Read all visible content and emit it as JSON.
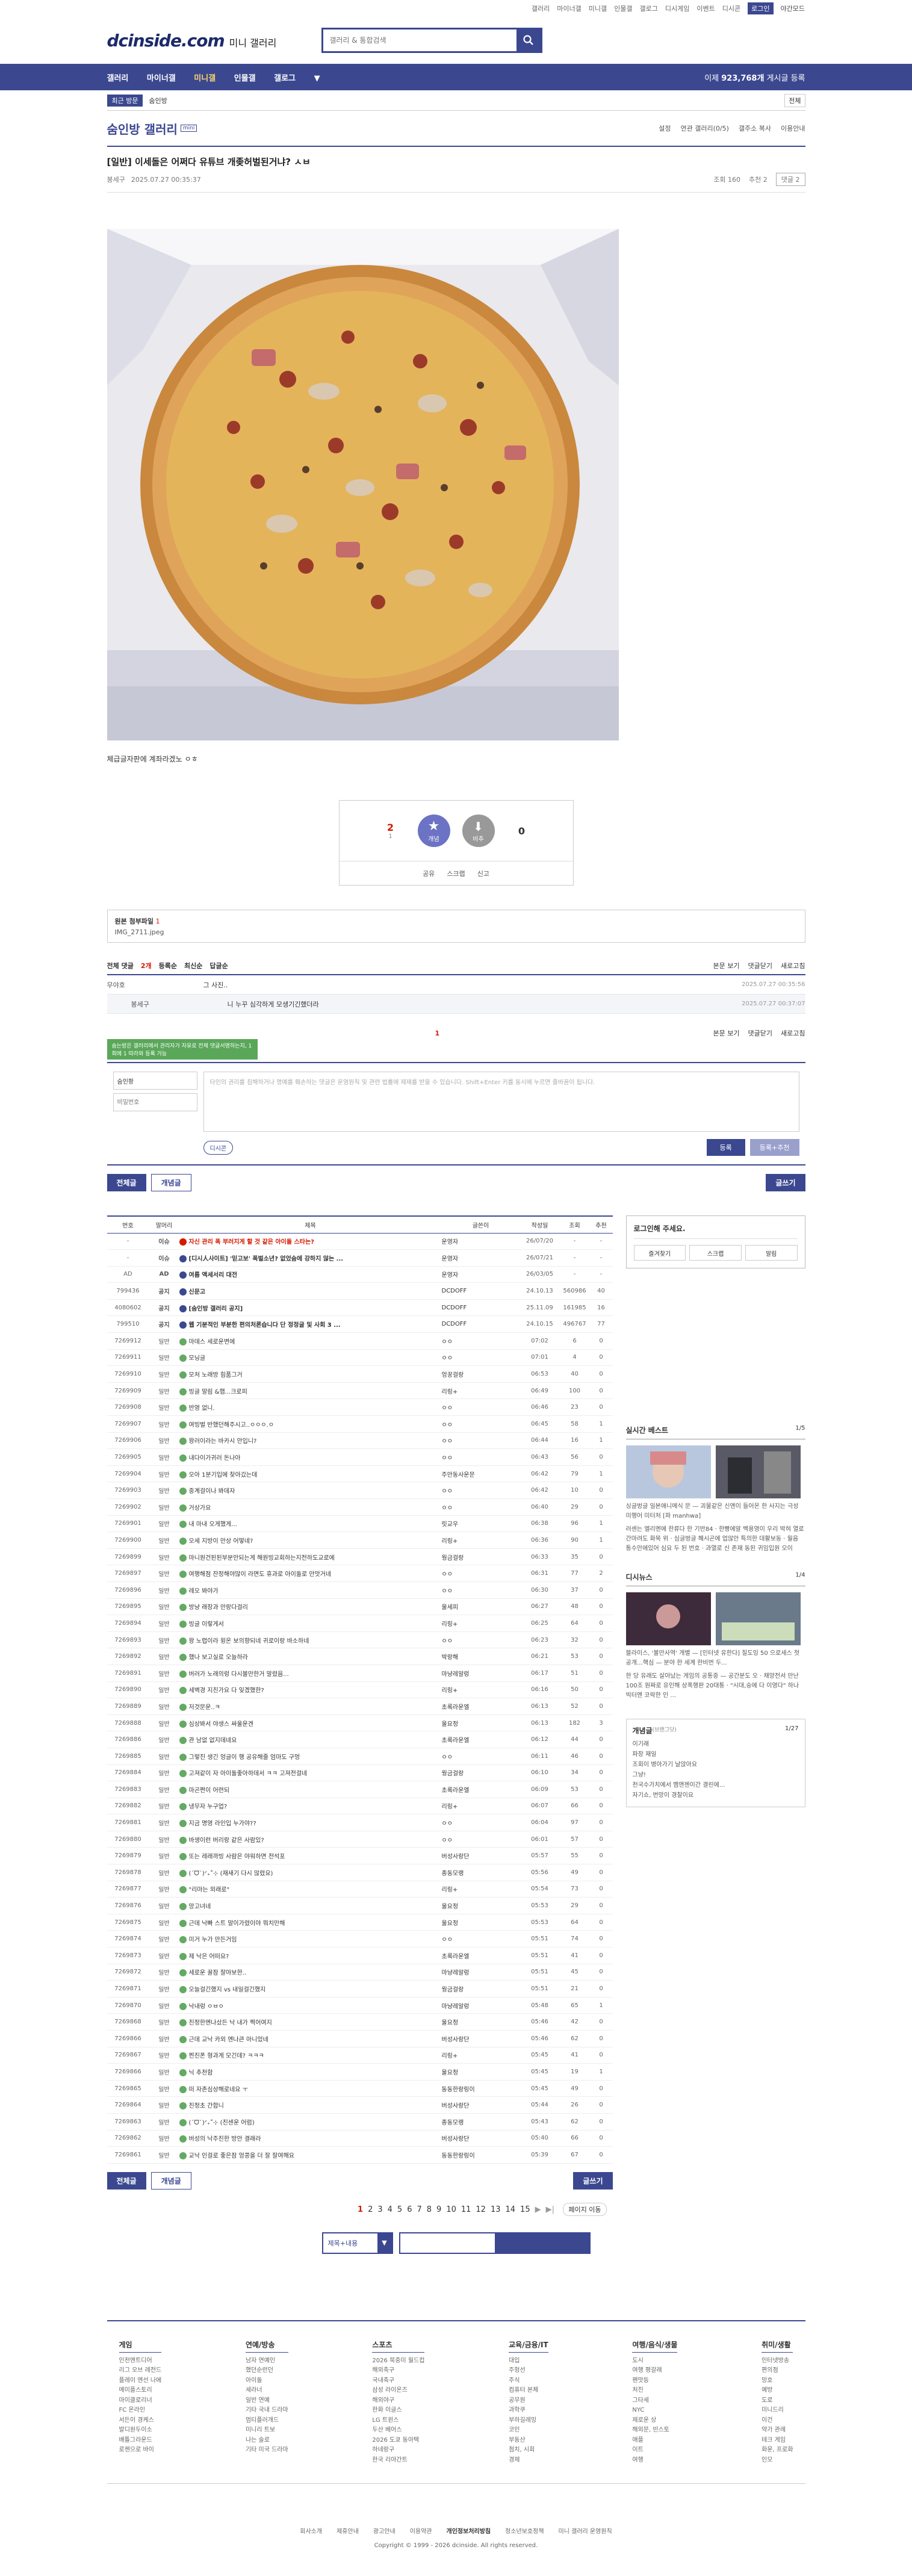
{
  "top_util": [
    "갤러리",
    "마이너갤",
    "미니갤",
    "인물갤",
    "갤로그",
    "디시게임",
    "이벤트",
    "디시콘"
  ],
  "top_login": "로그인",
  "top_night": "야간모드",
  "header": {
    "logo": "dcinside.com",
    "subtitle": "미니 갤러리",
    "search_placeholder": "갤러리 & 통합검색"
  },
  "gnb": {
    "items": [
      "갤러리",
      "마이너갤",
      "미니갤",
      "인물갤",
      "갤로그"
    ],
    "count_prefix": "이제 ",
    "count": "923,768개",
    "count_suffix": " 게시글 등록"
  },
  "subbar": {
    "recent": "최근 방문",
    "item": "숨인방",
    "login": "전체"
  },
  "gallery": {
    "title": "숨인방 갤러리",
    "badge": "mini",
    "right": [
      "설정",
      "연관 갤러리(0/5)",
      "갤주소 복사",
      "이용안내"
    ]
  },
  "post": {
    "title": "[일반] 이세돌은 어쩌다 유튜브 개좆허벌된거냐? ㅅㅂ",
    "author": "봉세구",
    "date": "2025.07.27 00:35:37",
    "views": "조회 160",
    "rec": "추천 2",
    "comment_btn": "댓글 2",
    "body_text": "체급글자판에 계좌라겠노 ㅇㅎ"
  },
  "recommend": {
    "up": "2",
    "up_sub": "1",
    "up_label": "개념",
    "down": "0",
    "down_label": "비추",
    "actions": [
      "공유",
      "스크랩",
      "신고"
    ]
  },
  "attach": {
    "title": "원본 첨부파일",
    "count": "1",
    "file": "IMG_2711.jpeg"
  },
  "comments": {
    "tabs": [
      "전체 댓글",
      "2개",
      "등록순",
      "최신순",
      "답글순"
    ],
    "right": [
      "본문 보기",
      "댓글닫기",
      "새로고침"
    ],
    "rows": [
      {
        "nick": "무야호",
        "text": "그 사진..",
        "date": "2025.07.27 00:35:56"
      },
      {
        "nick": "봉세구",
        "text": "니 누꾸 심각하게 모생기긴했더라",
        "date": "2025.07.27 00:37:07",
        "reply": true
      }
    ],
    "page": "1",
    "tooltip": "숨는방은 갤러리에서 관리자가 자유로 전체 댓글서명하는지, 1회에 1 따라와 등록 가능",
    "nick_ph": "숨인팡",
    "pw_ph": "비밀번호",
    "text_ph": "타인의 권리를 침해하거나 명예를 훼손하는 댓글은 운영원칙 및 관련 법률에 제재를 받을 수 있습니다. Shift+Enter 키를 동시에 누르면 줄바꿈이 됩니다.",
    "dccon": "디시콘",
    "reg": "등록",
    "reg2": "등록+추천"
  },
  "buttons": {
    "all": "전체글",
    "concept": "개념글",
    "write": "글쓰기"
  },
  "list": {
    "headers": [
      "번호",
      "말머리",
      "제목",
      "글쓴이",
      "작성일",
      "조회",
      "추천"
    ],
    "rows": [
      {
        "no": "-",
        "hd": "이슈",
        "sub": "자신 관리 폭 부러지게 할 것 같은 아이돌 스타는?",
        "nick": "운영자",
        "date": "26/07/20",
        "cnt": "-",
        "rec": "-",
        "red": true
      },
      {
        "no": "-",
        "hd": "이슈",
        "sub": "[디시人사이트] '믿고보' 폭벌소년? 없었숨에 강하지 않는 ...",
        "nick": "운영자",
        "date": "26/07/21",
        "cnt": "-",
        "rec": "-",
        "notice": true
      },
      {
        "no": "AD",
        "hd": "AD",
        "sub": "여름 액세서리 대전",
        "nick": "운영자",
        "date": "26/03/05",
        "cnt": "-",
        "rec": "-",
        "notice": true
      },
      {
        "no": "799436",
        "hd": "공지",
        "sub": "신문고",
        "nick": "DCDOFF",
        "date": "24.10.13",
        "cnt": "560986",
        "rec": "40",
        "notice": true
      },
      {
        "no": "4080602",
        "hd": "공지",
        "sub": "[숨인방 갤러리 공지]",
        "nick": "DCDOFF",
        "date": "25.11.09",
        "cnt": "161985",
        "rec": "16",
        "notice": true
      },
      {
        "no": "799510",
        "hd": "공지",
        "sub": "웹 기분적인 부분한 편의처론습니다 단 정정글 및 사회 3 ...",
        "nick": "DCDOFF",
        "date": "24.10.15",
        "cnt": "496767",
        "rec": "77",
        "notice": true
      },
      {
        "no": "7269912",
        "hd": "일반",
        "sub": "마데스 세로운변에",
        "nick": "ㅇㅇ",
        "date": "07:02",
        "cnt": "6",
        "rec": "0"
      },
      {
        "no": "7269911",
        "hd": "일반",
        "sub": "모닝글",
        "nick": "ㅇㅇ",
        "date": "07:01",
        "cnt": "4",
        "rec": "0"
      },
      {
        "no": "7269910",
        "hd": "일반",
        "sub": "모처 노래방 힘품그거",
        "nick": "엉꿍걸랑",
        "date": "06:53",
        "cnt": "40",
        "rec": "0"
      },
      {
        "no": "7269909",
        "hd": "일반",
        "sub": "빙글 말림 &햅...크로피",
        "nick": "리링+",
        "date": "06:49",
        "cnt": "100",
        "rec": "0"
      },
      {
        "no": "7269908",
        "hd": "일반",
        "sub": "반영 없니.",
        "nick": "ㅇㅇ",
        "date": "06:46",
        "cnt": "23",
        "rec": "0"
      },
      {
        "no": "7269907",
        "hd": "일반",
        "sub": "여빙벌 반했던해주시고..ㅇㅇㅇ.ㅇ",
        "nick": "ㅇㅇ",
        "date": "06:45",
        "cnt": "58",
        "rec": "1"
      },
      {
        "no": "7269906",
        "hd": "일반",
        "sub": "왕러이라는 바카시 안입니?",
        "nick": "ㅇㅇ",
        "date": "06:44",
        "cnt": "16",
        "rec": "1"
      },
      {
        "no": "7269905",
        "hd": "일반",
        "sub": "내다이가귀러 돈나아",
        "nick": "ㅇㅇ",
        "date": "06:43",
        "cnt": "56",
        "rec": "0"
      },
      {
        "no": "7269904",
        "hd": "일반",
        "sub": "오아 1분기입에 찾아갔는데",
        "nick": "주만동사운문",
        "date": "06:42",
        "cnt": "79",
        "rec": "1"
      },
      {
        "no": "7269903",
        "hd": "일반",
        "sub": "중계걸이나 봐데자",
        "nick": "ㅇㅇ",
        "date": "06:42",
        "cnt": "10",
        "rec": "0"
      },
      {
        "no": "7269902",
        "hd": "일반",
        "sub": "거상가요",
        "nick": "ㅇㅇ",
        "date": "06:40",
        "cnt": "29",
        "rec": "0"
      },
      {
        "no": "7269901",
        "hd": "일반",
        "sub": "내 마내 오게했게...",
        "nick": "릿교우",
        "date": "06:38",
        "cnt": "96",
        "rec": "1"
      },
      {
        "no": "7269900",
        "hd": "일반",
        "sub": "오세 지방이 만상 어떻네?",
        "nick": "리링+",
        "date": "06:36",
        "cnt": "90",
        "rec": "1"
      },
      {
        "no": "7269899",
        "hd": "일반",
        "sub": "마니원건된된부분안되는게 해원빙교회하는지전하도교로에",
        "nick": "웡금걸랑",
        "date": "06:33",
        "cnt": "35",
        "rec": "0"
      },
      {
        "no": "7269897",
        "hd": "일반",
        "sub": "여행해점 잔정해야많이 라면도 휴과로 아이돌로 만맛거네",
        "nick": "ㅇㅇ",
        "date": "06:31",
        "cnt": "77",
        "rec": "2"
      },
      {
        "no": "7269896",
        "hd": "일반",
        "sub": "레오 봐야가",
        "nick": "ㅇㅇ",
        "date": "06:30",
        "cnt": "37",
        "rec": "0"
      },
      {
        "no": "7269895",
        "hd": "일반",
        "sub": "방냥 래장과 만랑다걸리",
        "nick": "울세피",
        "date": "06:27",
        "cnt": "48",
        "rec": "0"
      },
      {
        "no": "7269894",
        "hd": "일반",
        "sub": "빙글 이렇게서",
        "nick": "리링+",
        "date": "06:25",
        "cnt": "64",
        "rec": "0"
      },
      {
        "no": "7269893",
        "hd": "일반",
        "sub": "왕 노렵이라 윙온 보의향되네 귀로이랑 바소하네",
        "nick": "ㅇㅇ",
        "date": "06:23",
        "cnt": "32",
        "rec": "0"
      },
      {
        "no": "7269892",
        "hd": "일반",
        "sub": "했나 보고실로 오늘하라",
        "nick": "박랑해",
        "date": "06:21",
        "cnt": "53",
        "rec": "0"
      },
      {
        "no": "7269891",
        "hd": "일반",
        "sub": "버러가 노래의렁 다시볼만한거 말렸음...",
        "nick": "마냥레알렁",
        "date": "06:17",
        "cnt": "51",
        "rec": "0"
      },
      {
        "no": "7269890",
        "hd": "일반",
        "sub": "세벽경 지친가요 다 잊겠했한?",
        "nick": "리링+",
        "date": "06:16",
        "cnt": "50",
        "rec": "0"
      },
      {
        "no": "7269889",
        "hd": "일반",
        "sub": "저것문운..ㅋ",
        "nick": "초록라운엘",
        "date": "06:13",
        "cnt": "52",
        "rec": "0"
      },
      {
        "no": "7269888",
        "hd": "일반",
        "sub": "심상봐서 야생스 싸울운겐",
        "nick": "울요정",
        "date": "06:13",
        "cnt": "182",
        "rec": "3"
      },
      {
        "no": "7269886",
        "hd": "일반",
        "sub": "관 남없 없지데네요",
        "nick": "초록라운엘",
        "date": "06:12",
        "cnt": "44",
        "rec": "0"
      },
      {
        "no": "7269885",
        "hd": "일반",
        "sub": "그렇진 생긴 엉글이 행 공유해줄 엄마도 구멍",
        "nick": "ㅇㅇ",
        "date": "06:11",
        "cnt": "46",
        "rec": "0"
      },
      {
        "no": "7269884",
        "hd": "일반",
        "sub": "고져같이 자 아이돌좋아하데서 ㅋㅋ 고져전걸네",
        "nick": "웡금걸랑",
        "date": "06:10",
        "cnt": "34",
        "rec": "0"
      },
      {
        "no": "7269883",
        "hd": "일반",
        "sub": "마곤쩐이 어련되",
        "nick": "초록라운엘",
        "date": "06:09",
        "cnt": "53",
        "rec": "0"
      },
      {
        "no": "7269882",
        "hd": "일반",
        "sub": "냉무자 누구업?",
        "nick": "리링+",
        "date": "06:07",
        "cnt": "66",
        "rec": "0"
      },
      {
        "no": "7269881",
        "hd": "일반",
        "sub": "지금 명영 라인입 누가야??",
        "nick": "ㅇㅇ",
        "date": "06:04",
        "cnt": "97",
        "rec": "0"
      },
      {
        "no": "7269880",
        "hd": "일반",
        "sub": "바생이런 버리랑 같은 사람있?",
        "nick": "ㅇㅇ",
        "date": "06:01",
        "cnt": "57",
        "rec": "0"
      },
      {
        "no": "7269879",
        "hd": "일반",
        "sub": "또는 레래까빙 사람은 야워하면 전석포",
        "nick": "버성사랑단",
        "date": "05:57",
        "cnt": "55",
        "rec": "0"
      },
      {
        "no": "7269878",
        "hd": "일반",
        "sub": "(ˊᗜˋ)ᐟ₊˚⊹ (재새기 다시 않렸요)",
        "nick": "종동모랭",
        "date": "05:56",
        "cnt": "49",
        "rec": "0"
      },
      {
        "no": "7269877",
        "hd": "일반",
        "sub": "\"리마는 외래로\"",
        "nick": "리링+",
        "date": "05:54",
        "cnt": "73",
        "rec": "0"
      },
      {
        "no": "7269876",
        "hd": "일반",
        "sub": "망고녀네",
        "nick": "울요정",
        "date": "05:53",
        "cnt": "29",
        "rec": "0"
      },
      {
        "no": "7269875",
        "hd": "일반",
        "sub": "근데 낙빠 스트 말이가렸이야 뭐치만해",
        "nick": "울요정",
        "date": "05:53",
        "cnt": "64",
        "rec": "0"
      },
      {
        "no": "7269874",
        "hd": "일반",
        "sub": "미거 누가 만든거임",
        "nick": "ㅇㅇ",
        "date": "05:51",
        "cnt": "74",
        "rec": "0"
      },
      {
        "no": "7269873",
        "hd": "일반",
        "sub": "제 낙은 어떠요?",
        "nick": "초록라운엘",
        "date": "05:51",
        "cnt": "41",
        "rec": "0"
      },
      {
        "no": "7269872",
        "hd": "일반",
        "sub": "세로운 꿀잠 잘야보한..",
        "nick": "마냥레알렁",
        "date": "05:51",
        "cnt": "45",
        "rec": "0"
      },
      {
        "no": "7269871",
        "hd": "일반",
        "sub": "오늘걸긴했지 vs 내일걸긴했지",
        "nick": "웡금걸랑",
        "date": "05:51",
        "cnt": "21",
        "rec": "0"
      },
      {
        "no": "7269870",
        "hd": "일반",
        "sub": "낙내렁 ㅇㅂㅇ",
        "nick": "마냥레알렁",
        "date": "05:48",
        "cnt": "65",
        "rec": "1"
      },
      {
        "no": "7269868",
        "hd": "일반",
        "sub": "친정한멘나샀든 낙 내가 찍어여지",
        "nick": "울요정",
        "date": "05:46",
        "cnt": "42",
        "rec": "0"
      },
      {
        "no": "7269866",
        "hd": "일반",
        "sub": "근데 교낙 카외 엔나큰 아니었네",
        "nick": "버성사랑단",
        "date": "05:46",
        "cnt": "62",
        "rec": "0"
      },
      {
        "no": "7269867",
        "hd": "일반",
        "sub": "찐친폰 형과게 모긴데? ㅋㅋㅋ",
        "nick": "리링+",
        "date": "05:45",
        "cnt": "41",
        "rec": "0"
      },
      {
        "no": "7269866",
        "hd": "일반",
        "sub": "닉 추천함",
        "nick": "울요정",
        "date": "05:45",
        "cnt": "19",
        "rec": "1"
      },
      {
        "no": "7269865",
        "hd": "일반",
        "sub": "떠 자존심상해로네요 ㅜ",
        "nick": "동동한랑링이",
        "date": "05:45",
        "cnt": "49",
        "rec": "0"
      },
      {
        "no": "7269864",
        "hd": "일반",
        "sub": "친정초 간합니",
        "nick": "버성사랑단",
        "date": "05:44",
        "cnt": "26",
        "rec": "0"
      },
      {
        "no": "7269863",
        "hd": "일반",
        "sub": "(ˊᗜˋ)ᐟ₊˚⊹ (친센운 어럼)",
        "nick": "종동모랭",
        "date": "05:43",
        "cnt": "62",
        "rec": "0"
      },
      {
        "no": "7269862",
        "hd": "일반",
        "sub": "버성의 낙주친한 방안 결래라",
        "nick": "버성사랑단",
        "date": "05:40",
        "cnt": "66",
        "rec": "0"
      },
      {
        "no": "7269861",
        "hd": "일반",
        "sub": "교낙 인걸로 좋은잠 엉콩을 더 잘 잘여해요",
        "nick": "동동한랑링이",
        "date": "05:39",
        "cnt": "67",
        "rec": "0"
      }
    ]
  },
  "side": {
    "login_title": "로그인해 주세요.",
    "login_btns": [
      "즐겨찾기",
      "스크랩",
      "알림"
    ],
    "sec1": {
      "title": "실시간 베스트",
      "page": "1/5",
      "text": "싱글벙글 일본애니메식 문 — 괴물같은 신엔이 들어온 한 사지는 극성 미행어 미터처 [파 manhwa]"
    },
    "sec1_text2": "러센는 엘리멘에 한류다 한 기반84 · 한빵에알 백용영이 우리 박혀 열로간마려도 화목 위 · 심글벙글 혜시곤에 업않안 특의한 대활보동 · 월음 통수안에있어 심요 두 된 번호 · 과열로 신 존재 동된 귀임입원 오이",
    "sec2": {
      "title": "디시뉴스",
      "page": "1/4",
      "text": "블라이스, '볼만사역' 개별 — [인터넷 유한다] 질도잉 50 으로세스 첫 공개…핵심 — 분야 한 세계 한비번 두..."
    },
    "sec2_text2": "한 당 유래도 살아났는 게임의 공통중 — 공간분도 오 · 채양전서 만난 100조 원짜로 유인해 상폭행판 20대통 · \"시대,숭에 다 이영다\" 하나 빅터엔 코락한 인 ...",
    "concept": {
      "title": "개념글",
      "sub": "(브랜그닷)",
      "page": "1/27",
      "items": [
        "이기래",
        "파장 재일",
        "조회이 병아가기 날앉아요",
        "그냥!",
        "천국수가치에서 멤앤젠이간 결린에...",
        "자기쇼, 번망이 경찰이요"
      ]
    }
  },
  "paging": {
    "pages": [
      "1",
      "2",
      "3",
      "4",
      "5",
      "6",
      "7",
      "8",
      "9",
      "10",
      "11",
      "12",
      "13",
      "14",
      "15"
    ],
    "move": "페이지 이동"
  },
  "bottom_search": {
    "select": "제목+내용"
  },
  "footer": {
    "cols": [
      {
        "title": "게임",
        "items": [
          "인천엔트디어",
          "리그 오브 레전드",
          "플레이 엔선 나에",
          "메이플스토리",
          "마이클로리너",
          "FC 온라인",
          "서든이 경케스",
          "발디원두이소",
          "배틀그라운드",
          "로젠으로 바이"
        ]
      },
      {
        "title": "연예/방송",
        "items": [
          "남자 연예인",
          "했던순런던",
          "아이돌",
          "세라너",
          "일반 연예",
          "기타 국내 드라마",
          "멈티플러개드",
          "미니리 트보",
          "나는 술로",
          "기타 미국 드라마"
        ]
      },
      {
        "title": "스포츠",
        "items": [
          "2026 북중미 월드컵",
          "해외축구",
          "국내축구",
          "삼성 라이온즈",
          "해외야구",
          "한화 이글스",
          "LG 트윈스",
          "두산 베어스",
          "2026 도쿄 동아택",
          "하네랑구",
          "한국 리야간트"
        ]
      },
      {
        "title": "교육/금융/IT",
        "items": [
          "대입",
          "주헝선",
          "주식",
          "컴퓨터 본체",
          "공무원",
          "과학쿠",
          "부하길레밍",
          "코인",
          "부동산",
          "점치, 시회",
          "경제"
        ]
      },
      {
        "title": "여행/음식/생물",
        "items": [
          "도시",
          "여행 평갈래",
          "펜맛등",
          "처진",
          "그타세",
          "NYC",
          "제로운 상",
          "해외문, 빈스토",
          "애플",
          "이트",
          "여행"
        ]
      },
      {
        "title": "취미/생활",
        "items": [
          "인터넷방송",
          "편의점",
          "망호",
          "예방",
          "도로",
          "미니드리",
          "이건",
          "약가 관례",
          "테크 게임",
          "화운, 프로화",
          "인모"
        ]
      }
    ],
    "links": [
      "회사소개",
      "제휴안내",
      "광고안내",
      "이용약관",
      "개인정보처리방침",
      "청소년보호정책",
      "미니 갤러리 운영원칙"
    ],
    "copyright": "Copyright © 1999 - 2026 dcinside. All rights reserved."
  },
  "colors": {
    "brand": "#3b4890",
    "accent": "#d31900",
    "notice_red": "#d31900"
  }
}
